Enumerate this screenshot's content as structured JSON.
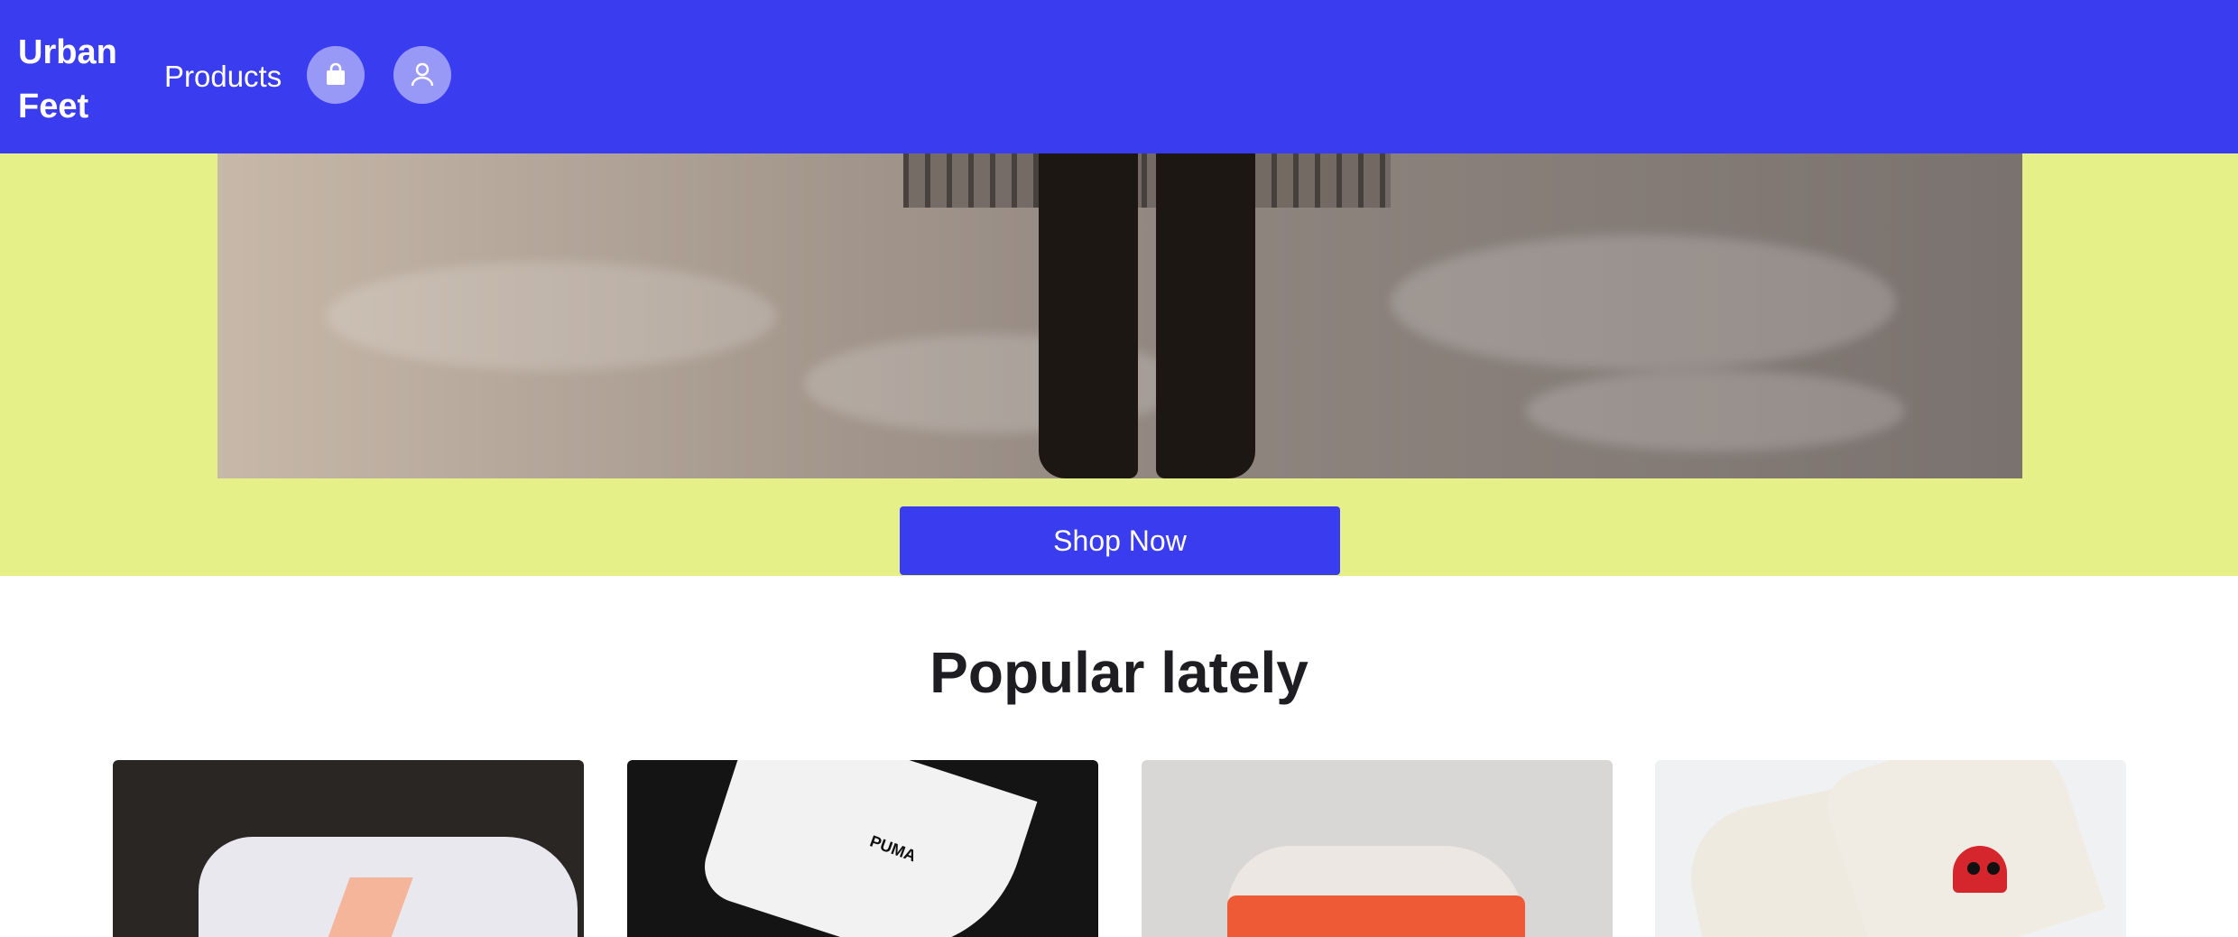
{
  "header": {
    "brand": "Urban Feet",
    "nav_products": "Products",
    "icons": [
      "shopping-bag-icon",
      "user-icon"
    ]
  },
  "hero": {
    "cta_label": "Shop Now"
  },
  "popular": {
    "title": "Popular lately",
    "cards": [
      {
        "image": "sneaker-white-peach-image"
      },
      {
        "image": "sneaker-white-puma-image"
      },
      {
        "image": "sneaker-orange-nike-image"
      },
      {
        "image": "sneaker-converse-heart-image"
      }
    ]
  },
  "colors": {
    "accent": "#3a3cf0",
    "hero_bg": "#e5f089",
    "title_text": "#1e1e22"
  }
}
